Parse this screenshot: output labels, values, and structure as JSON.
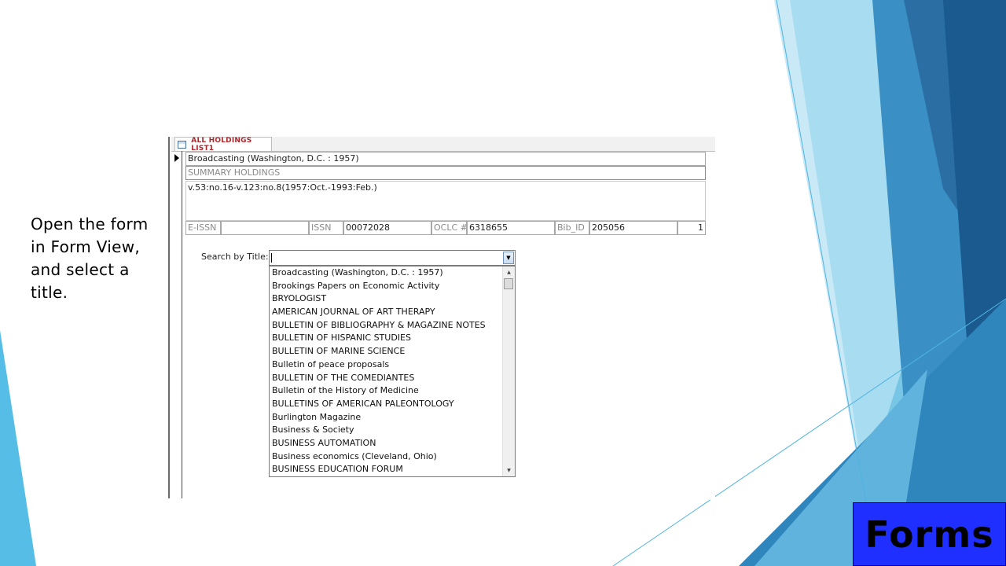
{
  "slide": {
    "instruction": "Open the form in Form View, and select a title.",
    "badge": "Forms"
  },
  "form": {
    "tab_label": "ALL HOLDINGS LIST1",
    "title_value": "Broadcasting (Washington, D.C. : 1957)",
    "summary_label": "SUMMARY HOLDINGS",
    "summary_value": "v.53:no.16-v.123:no.8(1957:Oct.-1993:Feb.)",
    "eissn_label": "E-ISSN",
    "eissn_value": "",
    "issn_label": "ISSN",
    "issn_value": "00072028",
    "oclc_label": "OCLC #",
    "oclc_value": "6318655",
    "bibid_label": "Bib_ID",
    "bibid_value": "205056",
    "trailing_value": "1"
  },
  "search": {
    "label": "Search by Title:",
    "value": "",
    "options": [
      "Broadcasting (Washington, D.C. : 1957)",
      "Brookings Papers on Economic Activity",
      "BRYOLOGIST",
      "AMERICAN JOURNAL OF ART THERAPY",
      "BULLETIN OF BIBLIOGRAPHY & MAGAZINE NOTES",
      "BULLETIN OF HISPANIC STUDIES",
      "BULLETIN OF MARINE SCIENCE",
      "Bulletin of peace proposals",
      "BULLETIN OF THE COMEDIANTES",
      "Bulletin of the History of Medicine",
      "BULLETINS OF AMERICAN PALEONTOLOGY",
      "Burlington Magazine",
      "Business & Society",
      "BUSINESS AUTOMATION",
      "Business economics (Cleveland, Ohio)",
      "BUSINESS EDUCATION FORUM"
    ]
  },
  "colors": {
    "badge_bg": "#1f2fff",
    "tab_text": "#b0262b"
  }
}
